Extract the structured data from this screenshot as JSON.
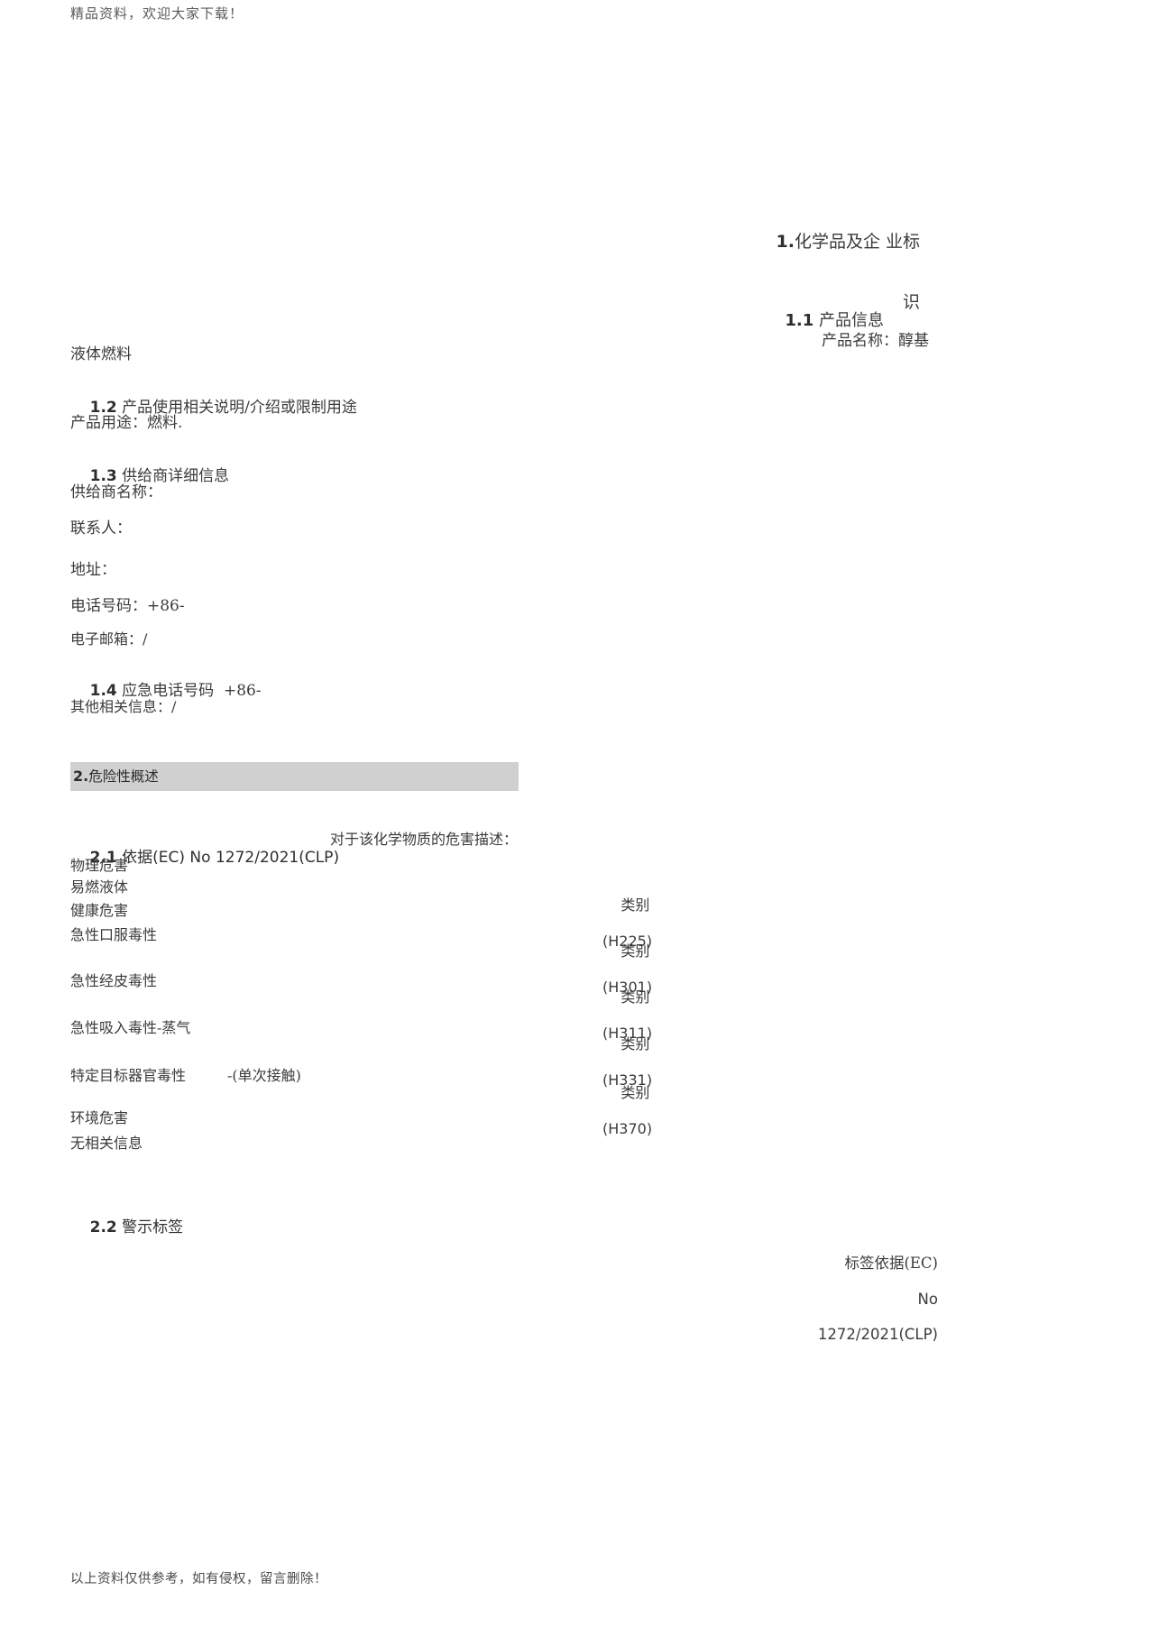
{
  "document": {
    "top_note": "精品资料，欢迎大家下载！",
    "bottom_note": "以上资料仅供参考，如有侵权，留言删除！"
  },
  "section1": {
    "heading_index": "1.",
    "heading_title": "化学品及企 业标",
    "heading_title_line2": "识",
    "subsection_1_1_index": "1.1",
    "subsection_1_1_title": "产品信息",
    "product_name_label": "产品名称：醇基",
    "product_name_continued": "液体燃料",
    "subsection_1_2_index": "1.2",
    "subsection_1_2_title": "产品使用相关说明/介绍或限制用途",
    "product_use": "产品用途：燃料.",
    "subsection_1_3_index": "1.3",
    "subsection_1_3_title": "供给商详细信息",
    "supplier_name": "供给商名称：",
    "contact_person": "联系人：",
    "address": "地址：",
    "phone": "电话号码：+86-",
    "email": "电子邮箱：/",
    "subsection_1_4_index": "1.4",
    "subsection_1_4_title": "应急电话号码  +86-",
    "other_info": "其他相关信息：/"
  },
  "section2": {
    "banner_index": "2.",
    "banner_title": "危险性概述",
    "subsection_2_1_index": "2.1",
    "subsection_2_1_title": "依据",
    "subsection_2_1_regulation": "(EC) No 1272/2021(CLP)",
    "subsection_2_1_description": "对于该化学物质的危害描述：",
    "hazard_groups": [
      {
        "group_label": "物理危害"
      },
      {
        "hazard": "易燃液体",
        "category_label": "类别",
        "hazard_code": "(H225)"
      },
      {
        "group_label": "健康危害"
      },
      {
        "hazard": "急性口服毒性",
        "category_label": "类别",
        "hazard_code": "(H301)"
      },
      {
        "hazard": "急性经皮毒性",
        "category_label": "类别",
        "hazard_code": "(H311)"
      },
      {
        "hazard": "急性吸入毒性-蒸气",
        "category_label": "类别",
        "hazard_code": "(H331)"
      },
      {
        "hazard": "特定目标器官毒性",
        "hazard_suffix": "-(单次接触)",
        "category_label": "类别",
        "hazard_code": "(H370)"
      },
      {
        "group_label": "环境危害"
      },
      {
        "group_label": "无相关信息"
      }
    ],
    "subsection_2_2_index": "2.2",
    "subsection_2_2_title": "警示标签",
    "label_basis_line1": "标签依据(EC)",
    "label_basis_line2": "No",
    "label_basis_line3": "1272/2021(CLP)"
  }
}
